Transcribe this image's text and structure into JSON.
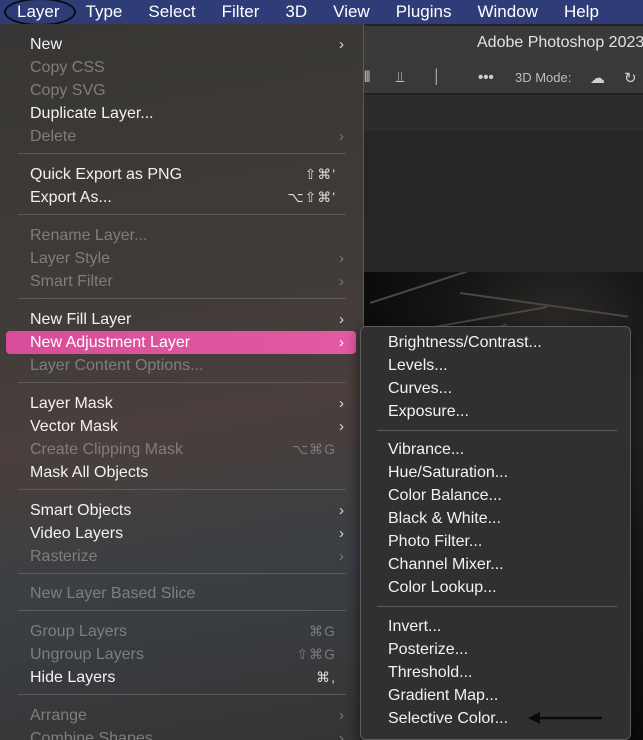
{
  "menubar": {
    "items": [
      "Layer",
      "Type",
      "Select",
      "Filter",
      "3D",
      "View",
      "Plugins",
      "Window",
      "Help"
    ]
  },
  "app": {
    "title": "Adobe Photoshop 2023",
    "options_label": "3D Mode:"
  },
  "layer_menu": {
    "items": [
      {
        "label": "New",
        "submenu": true,
        "disabled": false
      },
      {
        "label": "Copy CSS",
        "disabled": true
      },
      {
        "label": "Copy SVG",
        "disabled": true
      },
      {
        "label": "Duplicate Layer...",
        "disabled": false
      },
      {
        "label": "Delete",
        "submenu": true,
        "disabled": true
      },
      {
        "label": "Quick Export as PNG",
        "shortcut": "⇧⌘'",
        "disabled": false
      },
      {
        "label": "Export As...",
        "shortcut": "⌥⇧⌘'",
        "disabled": false
      },
      {
        "label": "Rename Layer...",
        "disabled": true
      },
      {
        "label": "Layer Style",
        "submenu": true,
        "disabled": true
      },
      {
        "label": "Smart Filter",
        "submenu": true,
        "disabled": true
      },
      {
        "label": "New Fill Layer",
        "submenu": true,
        "disabled": false
      },
      {
        "label": "New Adjustment Layer",
        "submenu": true,
        "disabled": false,
        "highlighted": true
      },
      {
        "label": "Layer Content Options...",
        "disabled": true
      },
      {
        "label": "Layer Mask",
        "submenu": true,
        "disabled": false
      },
      {
        "label": "Vector Mask",
        "submenu": true,
        "disabled": false
      },
      {
        "label": "Create Clipping Mask",
        "shortcut": "⌥⌘G",
        "disabled": true
      },
      {
        "label": "Mask All Objects",
        "disabled": false
      },
      {
        "label": "Smart Objects",
        "submenu": true,
        "disabled": false
      },
      {
        "label": "Video Layers",
        "submenu": true,
        "disabled": false
      },
      {
        "label": "Rasterize",
        "submenu": true,
        "disabled": true
      },
      {
        "label": "New Layer Based Slice",
        "disabled": true
      },
      {
        "label": "Group Layers",
        "shortcut": "⌘G",
        "disabled": true
      },
      {
        "label": "Ungroup Layers",
        "shortcut": "⇧⌘G",
        "disabled": true
      },
      {
        "label": "Hide Layers",
        "shortcut": "⌘,",
        "disabled": false
      },
      {
        "label": "Arrange",
        "submenu": true,
        "disabled": true
      },
      {
        "label": "Combine Shapes",
        "submenu": true,
        "disabled": true
      }
    ]
  },
  "adjustment_submenu": {
    "items": [
      "Brightness/Contrast...",
      "Levels...",
      "Curves...",
      "Exposure...",
      "Vibrance...",
      "Hue/Saturation...",
      "Color Balance...",
      "Black & White...",
      "Photo Filter...",
      "Channel Mixer...",
      "Color Lookup...",
      "Invert...",
      "Posterize...",
      "Threshold...",
      "Gradient Map...",
      "Selective Color..."
    ]
  },
  "colors": {
    "menubar": "#2e3d78",
    "highlight": "#d84d9a"
  }
}
